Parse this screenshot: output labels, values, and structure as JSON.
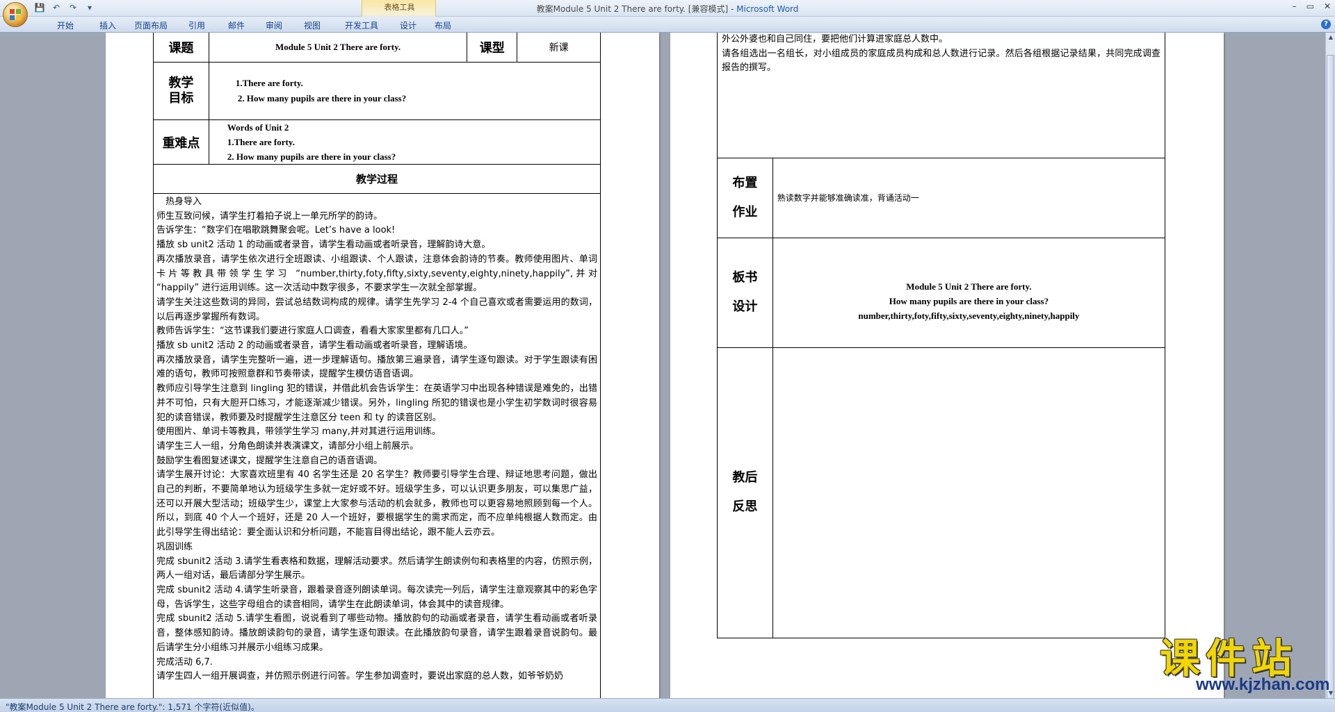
{
  "window": {
    "title_doc": "教案Module 5 Unit 2 There are forty. [兼容模式] - ",
    "title_app": "Microsoft Word",
    "table_tools_label": "表格工具",
    "controls": [
      "–",
      "▭",
      "✕"
    ]
  },
  "ribbon": {
    "tabs": [
      "开始",
      "插入",
      "页面布局",
      "引用",
      "邮件",
      "审阅",
      "视图",
      "开发工具",
      "设计",
      "布局"
    ],
    "help": "?"
  },
  "page1": {
    "title_label": "课题",
    "title_value": "Module 5 Unit 2 There are forty.",
    "type_label": "课型",
    "type_value": "新课",
    "goals_label": [
      "教学",
      "目标"
    ],
    "goals": [
      "1.There are forty.",
      "2. How many pupils are there in your class?"
    ],
    "key_label": "重难点",
    "key_lines": [
      "Words of Unit 2",
      "1.There are forty.",
      "2. How many pupils are there in your class?"
    ],
    "process_label": "教学过程",
    "process": [
      "　热身导入",
      "师生互致问候，请学生打着拍子说上一单元所学的韵诗。",
      "告诉学生：“数字们在唱歌跳舞聚会呢。Let’s have a look!",
      "播放 sb unit2 活动 1 的动画或者录音，请学生看动画或者听录音，理解韵诗大意。",
      "再次播放录音，请学生依次进行全班跟读、小组跟读、个人跟读，注意体会韵诗的节奏。教师使用图片、单词卡片等教具带领学生学习 “number,thirty,foty,fifty,sixty,seventy,eighty,ninety,happily”,并对 “happily” 进行运用训练。这一次活动中数字很多，不要求学生一次就全部掌握。",
      "请学生关注这些数词的异同，尝试总结数词构成的规律。请学生先学习 2-4 个自己喜欢或者需要运用的数词，以后再逐步掌握所有数词。",
      "教师告诉学生：“这节课我们要进行家庭人口调查，看看大家家里都有几口人。”",
      "播放 sb unit2 活动 2 的动画或者录音，请学生看动画或者听录音，理解语境。",
      "再次播放录音，请学生完整听一遍，进一步理解语句。播放第三遍录音，请学生逐句跟读。对于学生跟读有困难的语句，教师可按照意群和节奏带读，提醒学生模仿语音语调。",
      "教师应引导学生注意到 lingling 犯的错误，并借此机会告诉学生：在英语学习中出现各种错误是难免的，出错并不可怕，只有大胆开口练习，才能逐渐减少错误。另外，lingling 所犯的错误也是小学生初学数词时很容易犯的读音错误，教师要及时提醒学生注意区分 teen 和 ty 的读音区别。",
      "使用图片、单词卡等教具，带领学生学习 many,并对其进行运用训练。",
      "请学生三人一组，分角色朗读并表演课文，请部分小组上前展示。",
      "鼓励学生看图复述课文，提醒学生注意自己的语音语调。",
      "请学生展开讨论：大家喜欢班里有 40 名学生还是 20 名学生？教师要引导学生合理、辩证地思考问题，做出自己的判断，不要简单地认为班级学生多就一定好或不好。班级学生多，可以认识更多朋友，可以集思广益，还可以开展大型活动；班级学生少，课堂上大家参与活动的机会就多，教师也可以更容易地照顾到每一个人。所以，到底 40 个人一个班好，还是 20 人一个班好，要根据学生的需求而定，而不应单纯根据人数而定。由此引导学生得出结论：要全面认识和分析问题，不能盲目得出结论，跟不能人云亦云。",
      "巩固训练",
      "完成 sbunit2 活动 3.请学生看表格和数据，理解活动要求。然后请学生朗读例句和表格里的内容，仿照示例，两人一组对话，最后请部分学生展示。",
      "完成 sbunit2 活动 4.请学生听录音，跟着录音逐列朗读单词。每次读完一列后，请学生注意观察其中的彩色字母，告诉学生，这些字母组合的读音相同，请学生在此朗读单词，体会其中的读音规律。",
      "完成 sbunit2 活动 5.请学生看图，说说看到了哪些动物。播放韵句的动画或者录音，请学生看动画或者听录音，整体感知韵诗。播放朗读韵句的录音，请学生逐句跟读。在此播放韵句录音，请学生跟着录音说韵句。最后请学生分小组练习并展示小组练习成果。",
      "完成活动 6,7.",
      "请学生四人一组开展调查，并仿照示例进行问答。学生参加调查时，要说出家庭的总人数，如爷爷奶奶"
    ]
  },
  "page2": {
    "top_lines": [
      "外公外婆也和自己同住，要把他们计算进家庭总人数中。",
      "请各组选出一名组长，对小组成员的家庭成员构成和总人数进行记录。然后各组根据记录结果，共同完成调查报告的撰写。"
    ],
    "homework_label": [
      "布置",
      "作业"
    ],
    "homework": "熟读数字并能够准确读准，背诵活动一",
    "board_label": [
      "板书",
      "设计"
    ],
    "board_lines": [
      "Module 5 Unit 2 There are forty.",
      "How many pupils are there in your class?",
      "number,thirty,foty,fifty,sixty,seventy,eighty,ninety,happily"
    ],
    "reflection_label": [
      "教后",
      "反思"
    ]
  },
  "statusbar": {
    "text": "\"教案Module 5 Unit 2 There are forty.\": 1,571 个字符(近似值)。"
  },
  "watermark": {
    "cn": "课件站",
    "url": "www.kjzhan.com"
  },
  "colors": {
    "ribbon_text": "#15428b",
    "accent_yellow": "#f2d600",
    "page_bg": "#ffffff",
    "workspace_bg": "#9ea6b3"
  }
}
